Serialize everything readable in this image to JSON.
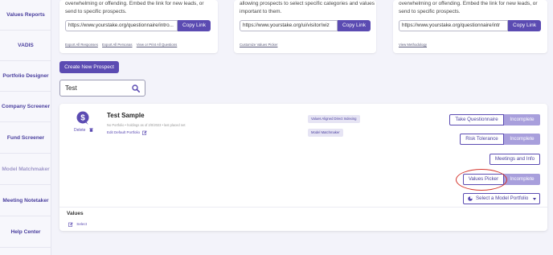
{
  "sidebar": {
    "items": [
      {
        "label": "Values Reports"
      },
      {
        "label": "VADIS"
      },
      {
        "label": "Portfolio Designer"
      },
      {
        "label": "Company Screener"
      },
      {
        "label": "Fund Screener"
      },
      {
        "label": "Model Matchmaker"
      },
      {
        "label": "Meeting Notetaker"
      },
      {
        "label": "Help Center"
      }
    ]
  },
  "cards": [
    {
      "desc": "overwhelming or offending. Embed the link for new leads, or send to specific prospects.",
      "url": "https://www.yourstake.org/questionnaire/intro...",
      "copy_label": "Copy Link",
      "links": [
        "Export All Responses",
        "Export All Personas",
        "View or Print All Questions"
      ]
    },
    {
      "desc": "allowing prospects to select specific categories and values important to them.",
      "url": "https://www.yourstake.org/ui/visitor/wiz",
      "copy_label": "Copy Link",
      "links": [
        "Customize Values Picker"
      ]
    },
    {
      "desc": "overwhelming or offending. Embed the link for new leads, or send to specific prospects.",
      "url": "https://www.yourstake.org/questionnaire/intr",
      "copy_label": "Copy Link",
      "links": [
        "View Methodology"
      ]
    }
  ],
  "create_prospect_label": "Create New Prospect",
  "search": {
    "value": "Test"
  },
  "prospect": {
    "name": "Test Sample",
    "delete_label": "Delete",
    "meta": "No Portfolio  •  holdings as of 2/0/2023  •  last placed net",
    "edit_portfolio_label": "Edit Default Portfolio",
    "tags": [
      "Values Aligned Direct Indexing",
      "Model Matchmaker"
    ],
    "actions": {
      "questionnaire_label": "Take Questionnaire",
      "questionnaire_status": "Incomplete",
      "risk_label": "Risk Tolerance",
      "risk_status": "Incomplete",
      "meetings_label": "Meetings and Info",
      "values_picker_label": "Values Picker",
      "values_picker_status": "Incomplete",
      "model_portfolio_label": "Select a Model Portfolio"
    },
    "values_title": "Values",
    "select_label": "Select"
  },
  "colors": {
    "accent": "#5b4bb2",
    "status": "#a89fdc",
    "highlight": "#d4342c"
  }
}
